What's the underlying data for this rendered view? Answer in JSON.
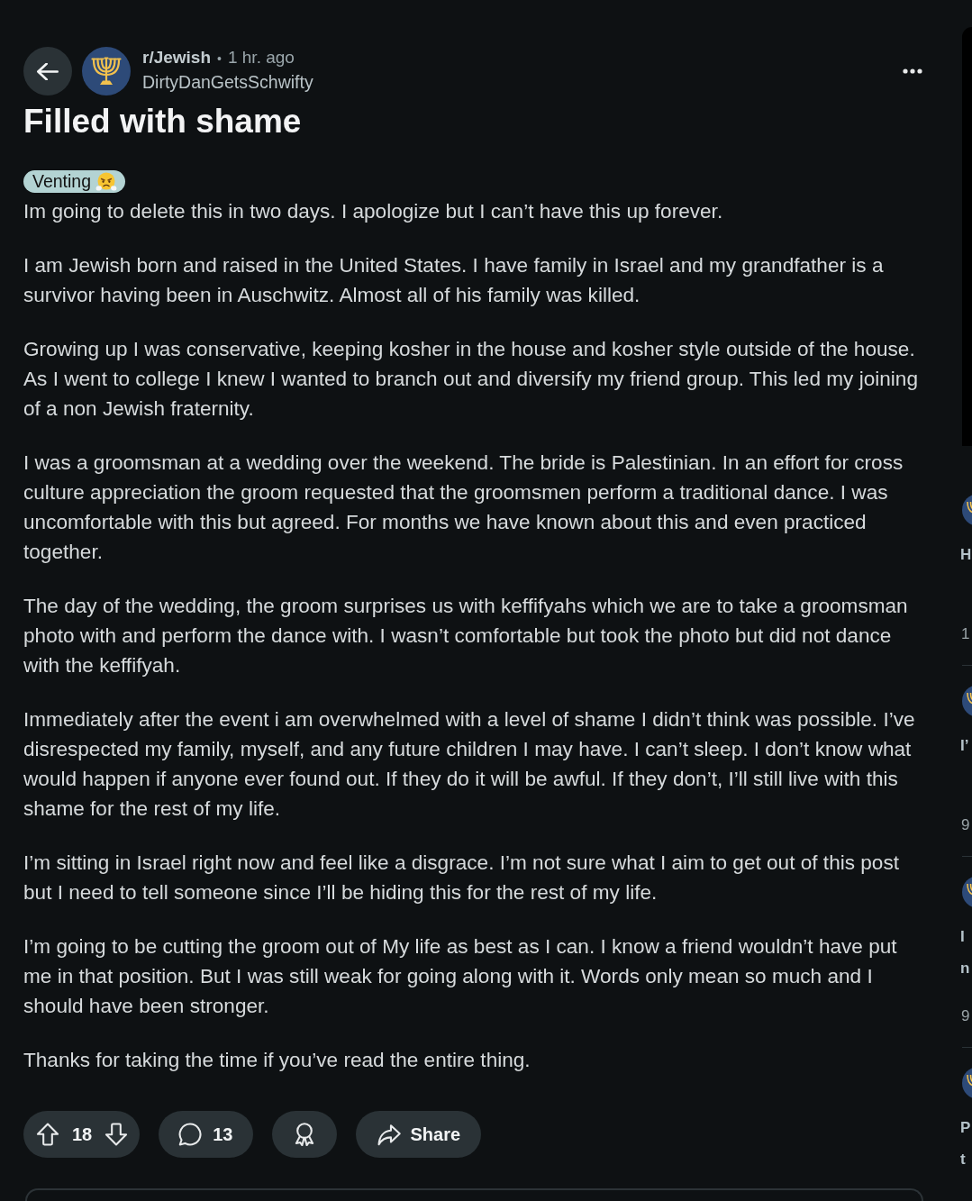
{
  "header": {
    "community": "r/Jewish",
    "separator": "•",
    "time": "1 hr. ago",
    "author": "DirtyDanGetsSchwifty"
  },
  "post": {
    "title": "Filled with shame",
    "flair": {
      "label": "Venting"
    },
    "paragraphs": [
      "Im going to delete this in two days. I apologize but I can’t have this up forever.",
      "I am Jewish born and raised in the United States. I have family in Israel and my grandfather is a survivor having been in Auschwitz. Almost all of his family was killed.",
      "Growing up I was conservative, keeping kosher in the house and kosher style outside of the house. As I went to college I knew I wanted to branch out and diversify my friend group. This led my joining of a non Jewish fraternity.",
      "I was a groomsman at a wedding over the weekend. The bride is Palestinian. In an effort for cross culture appreciation the groom requested that the groomsmen perform a traditional dance. I was uncomfortable with this but agreed. For months we have known about this and even practiced together.",
      "The day of the wedding, the groom surprises us with keffifyahs which we are to take a groomsman photo with and perform the dance with. I wasn’t comfortable but took the photo but did not dance with the keffifyah.",
      "Immediately after the event i am overwhelmed with a level of shame I didn’t think was possible. I’ve disrespected my family, myself, and any future children I may have. I can’t sleep. I don’t know what would happen if anyone ever found out. If they do it will be awful. If they don’t, I’ll still live with this shame for the rest of my life.",
      "I’m sitting in Israel right now and feel like a disgrace. I’m not sure what I aim to get out of this post but I need to tell someone since I’ll be hiding this for the rest of my life.",
      "I’m going to be cutting the groom out of My life as best as I can. I know a friend wouldn’t have put me in that position. But I was still weak for going along with it. Words only mean so much and I should have been stronger.",
      "Thanks for taking the time if you’ve read the entire thing."
    ]
  },
  "actions": {
    "votes": "18",
    "comments": "13",
    "share": "Share"
  },
  "side_posts": [
    {
      "title_lines": [
        "H"
      ],
      "meta": "1"
    },
    {
      "title_lines": [
        "I’"
      ],
      "meta": "9"
    },
    {
      "title_lines": [
        "I",
        "n"
      ],
      "meta": "9"
    },
    {
      "title_lines": [
        "P",
        "t"
      ]
    }
  ]
}
